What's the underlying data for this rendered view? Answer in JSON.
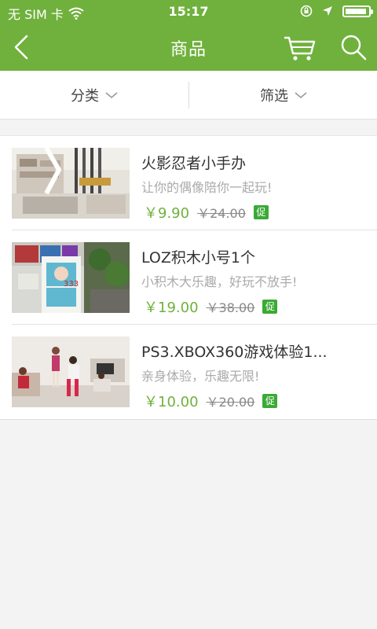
{
  "status_bar": {
    "carrier": "无 SIM 卡",
    "time": "15:17"
  },
  "navbar": {
    "title": "商品"
  },
  "filters": [
    {
      "label": "分类"
    },
    {
      "label": "筛选"
    }
  ],
  "products": [
    {
      "title": "火影忍者小手办",
      "subtitle": "让你的偶像陪你一起玩!",
      "price": "￥9.90",
      "old_price": "￥24.00",
      "promo": "促"
    },
    {
      "title": "LOZ积木小号1个",
      "subtitle": "小积木大乐趣，好玩不放手!",
      "price": "￥19.00",
      "old_price": "￥38.00",
      "promo": "促"
    },
    {
      "title": "PS3.XBOX360游戏体验1...",
      "subtitle": "亲身体验，乐趣无限!",
      "price": "￥10.00",
      "old_price": "￥20.00",
      "promo": "促"
    }
  ],
  "colors": {
    "accent": "#6fb13c",
    "promo_badge": "#3aaa35"
  }
}
